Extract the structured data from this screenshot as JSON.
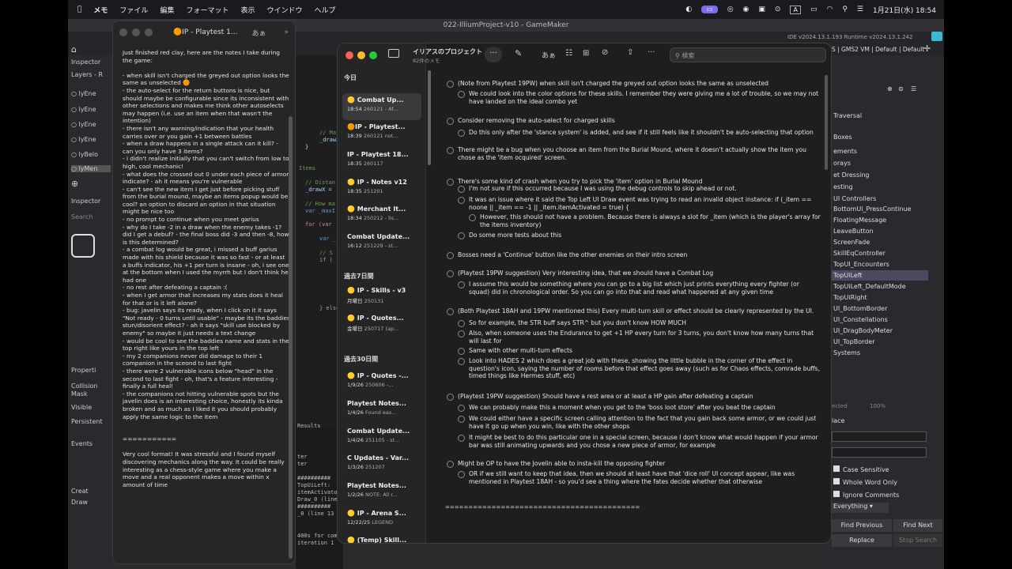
{
  "menubar": {
    "items": [
      "メモ",
      "ファイル",
      "編集",
      "フォーマット",
      "表示",
      "ウインドウ",
      "ヘルプ"
    ],
    "clock": "1月21日(水) 18:54",
    "input": "A"
  },
  "gm": {
    "title": "022-IlliumProject-v10 - GameMaker",
    "version": "IDE v2024.13.1.193 Runtime v2024.13.1.242",
    "target": "S | GMS2 VM | Default | Default",
    "left": [
      "Inspector",
      "Layers - R",
      "lyEne",
      "lyEne",
      "lyEne",
      "lyEne",
      "lyBelo",
      "lyMen",
      "Inspector",
      "Search",
      "Properti",
      "Collision",
      "Mask",
      "Visible",
      "Persistent",
      "Events",
      "Creat",
      "Draw"
    ],
    "code": [
      "// Ma",
      "_drawX",
      "}",
      "Items",
      "// Distan",
      "_drawX =",
      "// How ma",
      "var _maxI",
      "for (var",
      "var _",
      "// S",
      "if (",
      "} else",
      "Results"
    ],
    "output": [
      "ter",
      "ter",
      "##########",
      "TopUiLeft:",
      "itemActivato",
      "Draw_0 (line",
      "##########",
      "_0 (line 13",
      "400s for com",
      "iteration 1"
    ],
    "assets": [
      "Traversal",
      "Boxes",
      "ements",
      "orays",
      "et Dressing",
      "esting",
      "UI Controllers",
      "BottomUi_PressContinue",
      "FloatingMessage",
      "LeaveButton",
      "ScreenFade",
      "SkillEqController",
      "TopUI_Encounters",
      "TopUiLeft",
      "TopUiLeft_DefaultMode",
      "TopUiRight",
      "UI_BottomBorder",
      "UI_Constellations",
      "UI_DragBodyMeter",
      "UI_TopBorder",
      "Systems"
    ],
    "search": {
      "case": "Case Sensitive",
      "whole": "Whole Word Only",
      "ignore": "Ignore Comments",
      "scope": "Everything",
      "prev": "Find Previous",
      "next": "Find Next",
      "replace": "Replace",
      "stop": "Stop Search",
      "place": "lace",
      "zoom": "100%",
      "sel": "ected"
    }
  },
  "note": {
    "title": "IP - Playtest 1...",
    "input": "あぁ",
    "body": "Just finished red clay, here are the notes I take during the game:\n\n- when skill isn't charged the greyed out option looks the same as unselected 🟠\n- the auto-select for the return buttons is nice, but should maybe be configurable since its inconsistent with other selections and makes me think other autoselects may happen (i.e. use an item when that wasn't the intention)\n- there isn't any warning/indication that your health carries over or you gain +1 between battles\n- when a draw happens in a single attack can it kill? - can you only have 3 items?\n- i didn't realize initially that you can't switch from low to high, cool mechanic!\n- what does the crossed out 0 under each piece of armor indicate? - ah it means you're vulnerable\n- can't see the new item I get just before picking stuff from the burial mound, maybe an items popup would be cool? an option to discard an option in that situation might be nice too\n- no prompt to continue when you meet garius\n- why do I take -2 in a draw when the enemy takes -1? did I get a debuf? - the final boss did -3 and then -8, how is this determined?\n- a combat log would be great, i missed a buff garius made with his shield because it was so fast - or at least a buffs indicator, his +1 per turn is insane - oh, i see one at the bottom when I used the myrrh but I don't think he had one\n- no rest after defeating a captain :(\n- when I get armor that increases my stats does it heal for that or is it left alone?\n- bug: javelin says its ready, when I click on it it says \"Not ready - 0 turns until usable\" - maybe its the baddies stun/disorient effect? - ah it says \"skill use blocked by enemy\" so maybe it just needs a text change\n- would be cool to see the baddies name and stats in the top right like yours in the top left\n- my 2 companions never did damage to their 1 companion in the sceond to last fight\n- there were 2 vulnerable icons below \"head\" in the second to last fight - oh, that's a feature interesting - finally a full heal!\n- the companions not hitting vulnerable spots but the javelin does is an interesting choice, honestly its kinda broken and as much as I liked it you should probably apply the same logic to the item\n\n\n===========\n\nVery cool format! It was stressful and I found myself discovering mechanics along the way. It could be really interesting as a chess-style game where you make a move and a real opponent makes a move within x amount of time"
  },
  "notes": {
    "folder": "イリアスのプロジェクト",
    "count": "82件のメモ",
    "search": "検索",
    "fmt": "あぁ",
    "sections": [
      "今日",
      "過去7日間",
      "過去30日間"
    ],
    "list": [
      {
        "t": "🟡 Combat Up...",
        "d": "18:54",
        "p": "260121 - Af..."
      },
      {
        "t": "🟠IP - Playtest...",
        "d": "18:39",
        "p": "260121 not..."
      },
      {
        "t": "IP - Playtest 18...",
        "d": "18:35",
        "p": "260117"
      },
      {
        "t": "🟡 IP - Notes v12",
        "d": "18:35",
        "p": "251201"
      },
      {
        "t": "🟡 Merchant It...",
        "d": "18:34",
        "p": "250212 - lis..."
      },
      {
        "t": "Combat Update...",
        "d": "16:12",
        "p": "251229 - st..."
      },
      {
        "t": "🟡 IP - Skills - v3",
        "d": "月曜日",
        "p": "250131"
      },
      {
        "t": "🟡 IP - Quotes...",
        "d": "金曜日",
        "p": "250717 (ap..."
      },
      {
        "t": "🟡 IP - Quotes -...",
        "d": "1/9/26",
        "p": "250606 -..."
      },
      {
        "t": "Playtest Notes...",
        "d": "1/4/26",
        "p": "Found eas..."
      },
      {
        "t": "Combat Update...",
        "d": "1/4/26",
        "p": "251105 - st..."
      },
      {
        "t": "C Updates - Var...",
        "d": "1/3/26",
        "p": "251207"
      },
      {
        "t": "Playtest Notes...",
        "d": "1/2/26",
        "p": "NOTE: All r..."
      },
      {
        "t": "🟡 IP - Arena S...",
        "d": "12/22/25",
        "p": "LEGEND"
      },
      {
        "t": "🟡 (Temp) Skill...",
        "d": "",
        "p": ""
      }
    ],
    "content": [
      {
        "l": 0,
        "t": "(Note from Playtest 19PW) when skill isn't charged the greyed out option looks the same as unselected"
      },
      {
        "l": 1,
        "t": "We could look into the color options for these skills. I remember they were giving me a lot of trouble, so we may not have landed on the ideal combo yet"
      },
      {
        "l": 0,
        "t": "Consider removing the auto-select for charged skills"
      },
      {
        "l": 1,
        "t": "Do this only after the 'stance system' is added, and see if it still feels like it shouldn't be auto-selecting that option"
      },
      {
        "l": 0,
        "t": "There might be a bug when you choose an item from the Burial Mound, where it doesn't actually show the item you chose as the 'item ocquired' screen."
      },
      {
        "l": 0,
        "t": "There's some kind of crash when you try to pick the 'item' option in Burial Mound"
      },
      {
        "l": 1,
        "t": "I'm not sure if this occurred because I was using the debug controls to skip ahead or not."
      },
      {
        "l": 1,
        "t": "It was an issue where it said the Top Left UI Draw event was trying to read an invalid object instance: if (_item == noone || _item == -1 || _item.itemActivated = true) {"
      },
      {
        "l": 2,
        "t": "However, this should not have a problem. Because there is always a slot for _item (which is the player's array for the items inventory)"
      },
      {
        "l": 1,
        "t": "Do some more tests about this"
      },
      {
        "l": 0,
        "t": "Bosses need a 'Continue' button like the other enemies on their intro screen"
      },
      {
        "l": 0,
        "t": "(Playtest 19PW suggestion) Very interesting idea, that we should have a Combat Log"
      },
      {
        "l": 1,
        "t": "I assume this would be something where you can go to a big list which just prints everything every fighter (or squad) did in chronological order. So you can go into that and read what happened at any given time"
      },
      {
        "l": 0,
        "t": "(Both Playtest 18AH and 19PW mentioned this) Every multi-turn skill or effect should be clearly represented by the UI."
      },
      {
        "l": 1,
        "t": "So for example, the STR buff says STR^ but you don't know HOW MUCH"
      },
      {
        "l": 1,
        "t": "Also, when someone uses the Endurance to get +1 HP every turn for 3 turns, you don't know how many turns that will last for"
      },
      {
        "l": 1,
        "t": "Same with other multi-turn effects"
      },
      {
        "l": 1,
        "t": "Look into HADES 2 which does a great job with these, showing the little bubble in the corner of the effect in question's icon, saying the number of rooms before that effect goes away (such as for Chaos effects, comrade buffs, timed things like Hermes stuff, etc)"
      },
      {
        "l": 0,
        "t": "(Playtest 19PW suggestion) Should have a rest area or at least a HP gain after defeating a captain"
      },
      {
        "l": 1,
        "t": "We can probably make this a moment when you get to the 'boss loot store' after you beat the captain"
      },
      {
        "l": 1,
        "t": "We could either have a specific screen calling attention to the fact that you gain back some armor, or we could just have it go up when you win, like with the other shops"
      },
      {
        "l": 1,
        "t": "It might be best to do this particular one in a special screen, because I don't know what would happen if your armor bar was still animating upwards and you chose a new piece of armor, for example"
      },
      {
        "l": 0,
        "t": "Might be OP to have the Jovelin able to insta-kill the opposing fighter"
      },
      {
        "l": 1,
        "t": "OR if we still want to keep that idea, then we should at least have that 'dice roll' UI concept appear, like was mentioned in Playtest 18AH - so you'd see a thing where the fates decide whether that otherwise"
      }
    ],
    "divider": "=========================================="
  }
}
